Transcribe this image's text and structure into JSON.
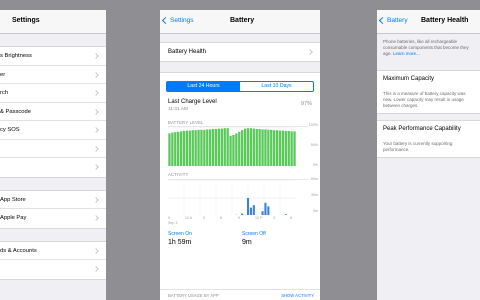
{
  "screen1": {
    "title": "Settings",
    "group1": [
      "s Brightness",
      "er",
      "rch",
      "& Passcode",
      "cy SOS",
      ""
    ],
    "group2": [
      "App Store",
      "Apple Pay"
    ],
    "group3": [
      "ds & Accounts",
      ""
    ]
  },
  "screen2": {
    "back_label": "Settings",
    "title": "Battery",
    "battery_health_label": "Battery Health",
    "segments": [
      "Last 24 Hours",
      "Last 10 Days"
    ],
    "last_charge_title": "Last Charge Level",
    "last_charge_time": "11:31 AM",
    "last_charge_value": "97%",
    "battery_level_label": "BATTERY LEVEL",
    "activity_label": "ACTIVITY",
    "level_axis": [
      "100%",
      "50%",
      "0%"
    ],
    "activity_axis": [
      "60m",
      "30m",
      "0m"
    ],
    "x_ticks": [
      "9",
      "12 A",
      "3",
      "6",
      "9",
      "12 P",
      "3",
      "6"
    ],
    "x_date": "Sep 3",
    "screen_on_label": "Screen On",
    "screen_on_value": "1h 59m",
    "screen_off_label": "Screen Off",
    "screen_off_value": "9m",
    "usage_label": "BATTERY USAGE BY APP",
    "show_activity": "SHOW ACTIVITY"
  },
  "screen3": {
    "back_label": "Battery",
    "title": "Battery Health",
    "intro": "Phone batteries, like all rechargeable consumable components that become they age.",
    "learn_more": "Learn more...",
    "max_capacity_label": "Maximum Capacity",
    "max_capacity_desc": "This is a measure of battery capacity was new. Lower capacity may result in usage between charges.",
    "peak_label": "Peak Performance Capability",
    "peak_desc": "Your battery is currently supporting performance."
  },
  "chart_data": [
    {
      "type": "area",
      "title": "BATTERY LEVEL",
      "xlabel": "",
      "ylabel": "",
      "ylim": [
        0,
        100
      ],
      "x": [
        "9",
        "12 A",
        "3",
        "6",
        "9",
        "12 P",
        "3",
        "6"
      ],
      "series": [
        {
          "values": [
            84,
            86,
            87,
            88,
            89,
            90,
            91,
            91,
            92,
            92,
            93,
            93,
            93,
            94,
            94,
            95,
            95,
            96,
            96,
            97,
            97,
            78,
            80,
            84,
            88,
            92,
            96,
            97,
            97,
            96,
            95,
            95,
            94,
            94,
            93,
            93,
            92,
            92,
            91,
            91,
            90,
            90,
            89,
            89
          ]
        }
      ]
    },
    {
      "type": "bar",
      "title": "ACTIVITY",
      "xlabel": "",
      "ylabel": "",
      "ylim": [
        0,
        60
      ],
      "x": [
        "9",
        "12 A",
        "3",
        "6",
        "9",
        "12 P",
        "3",
        "6"
      ],
      "series": [
        {
          "values": [
            1,
            0,
            0,
            0,
            0,
            0,
            0,
            0,
            0,
            0,
            0,
            0,
            0,
            0,
            0,
            0,
            0,
            0,
            0,
            0,
            0,
            0,
            0,
            2,
            0,
            4,
            0,
            30,
            14,
            18,
            0,
            0,
            8,
            22,
            16,
            0,
            0,
            0,
            0,
            0,
            3,
            0,
            0,
            0
          ]
        }
      ]
    }
  ]
}
